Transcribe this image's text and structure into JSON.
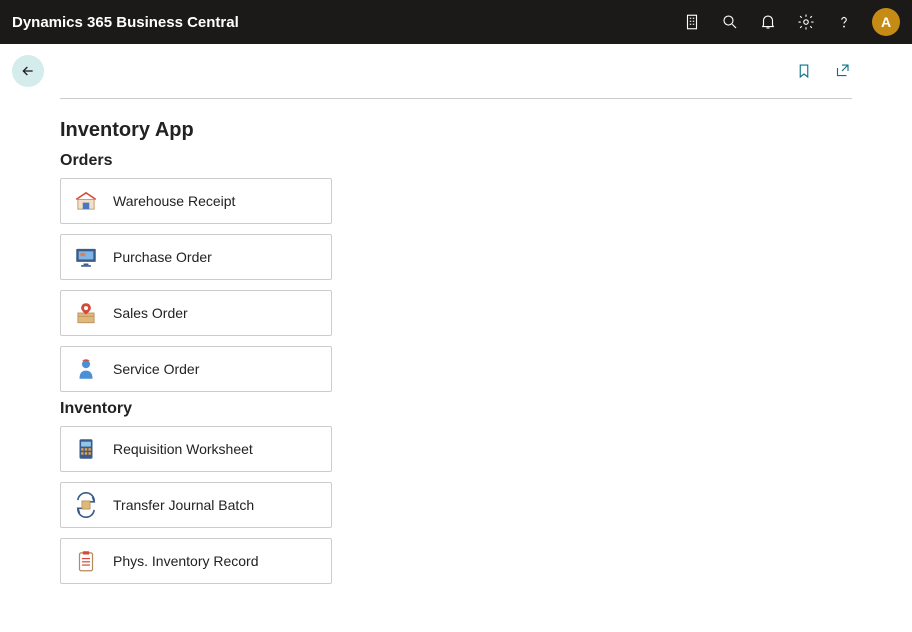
{
  "header": {
    "title": "Dynamics 365 Business Central",
    "avatar_initial": "A"
  },
  "page": {
    "title": "Inventory App"
  },
  "sections": {
    "orders": {
      "title": "Orders",
      "items": [
        {
          "label": "Warehouse Receipt",
          "icon": "warehouse-icon"
        },
        {
          "label": "Purchase Order",
          "icon": "monitor-icon"
        },
        {
          "label": "Sales Order",
          "icon": "package-pin-icon"
        },
        {
          "label": "Service Order",
          "icon": "service-person-icon"
        }
      ]
    },
    "inventory": {
      "title": "Inventory",
      "items": [
        {
          "label": "Requisition Worksheet",
          "icon": "calculator-icon"
        },
        {
          "label": "Transfer Journal Batch",
          "icon": "transfer-icon"
        },
        {
          "label": "Phys. Inventory Record",
          "icon": "clipboard-icon"
        }
      ]
    }
  }
}
